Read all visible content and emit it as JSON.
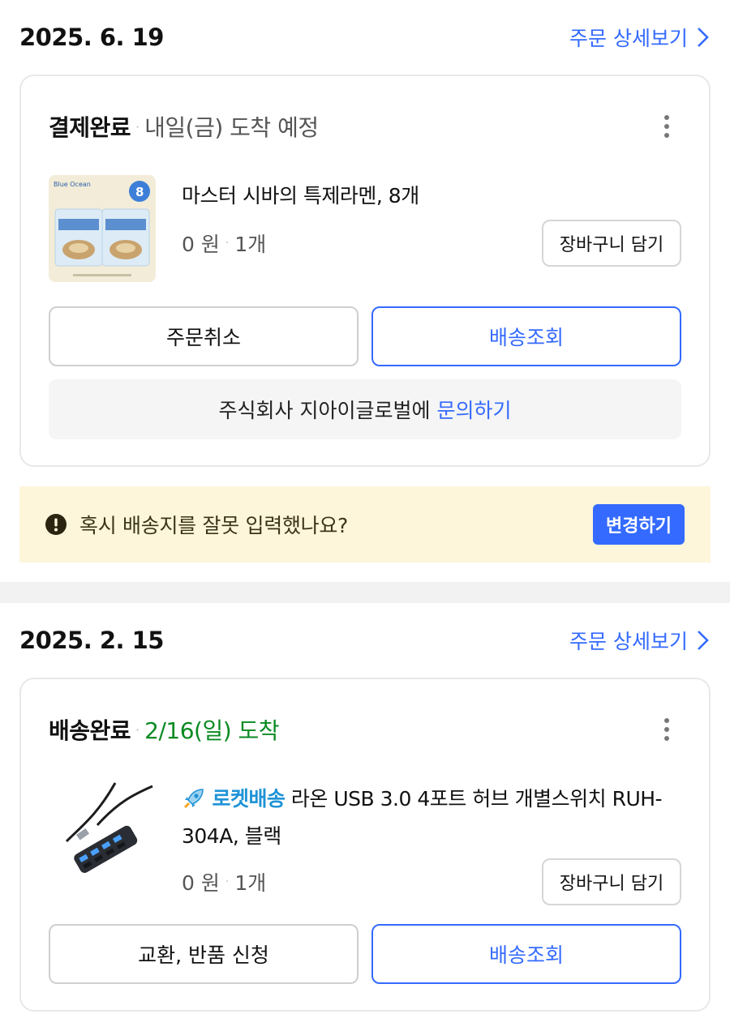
{
  "orders": [
    {
      "date": "2025. 6. 19",
      "detail_link": "주문 상세보기",
      "status": "결제완료",
      "status_desc": "내일(금) 도착 예정",
      "product": {
        "badge": "",
        "name": "마스터 시바의 특제라멘, 8개",
        "price": "0 원",
        "qty": "1개",
        "thumb_icon": "ramen-package-image"
      },
      "cart_button": "장바구니 담기",
      "left_button": "주문취소",
      "right_button": "배송조회",
      "inquiry": {
        "text": "주식회사 지아이글로벌에",
        "link": "문의하기"
      }
    },
    {
      "date": "2025. 2. 15",
      "detail_link": "주문 상세보기",
      "status": "배송완료",
      "status_desc": "2/16(일) 도착",
      "status_color": "#0a8a22",
      "product": {
        "badge": "로켓배송",
        "badge_icon": "rocket-icon",
        "name": "라온 USB 3.0 4포트 허브 개별스위치 RUH-304A, 블랙",
        "price": "0 원",
        "qty": "1개",
        "thumb_icon": "usb-hub-image"
      },
      "cart_button": "장바구니 담기",
      "left_button": "교환, 반품 신청",
      "right_button": "배송조회"
    }
  ],
  "notice": {
    "icon": "exclamation-circle-icon",
    "text": "혹시 배송지를 잘못 입력했나요?",
    "button": "변경하기"
  },
  "colors": {
    "accent": "#346aff",
    "delivered": "#0a8a22",
    "notice_bg": "#fdf6db",
    "rocket": "#1f93d6"
  }
}
